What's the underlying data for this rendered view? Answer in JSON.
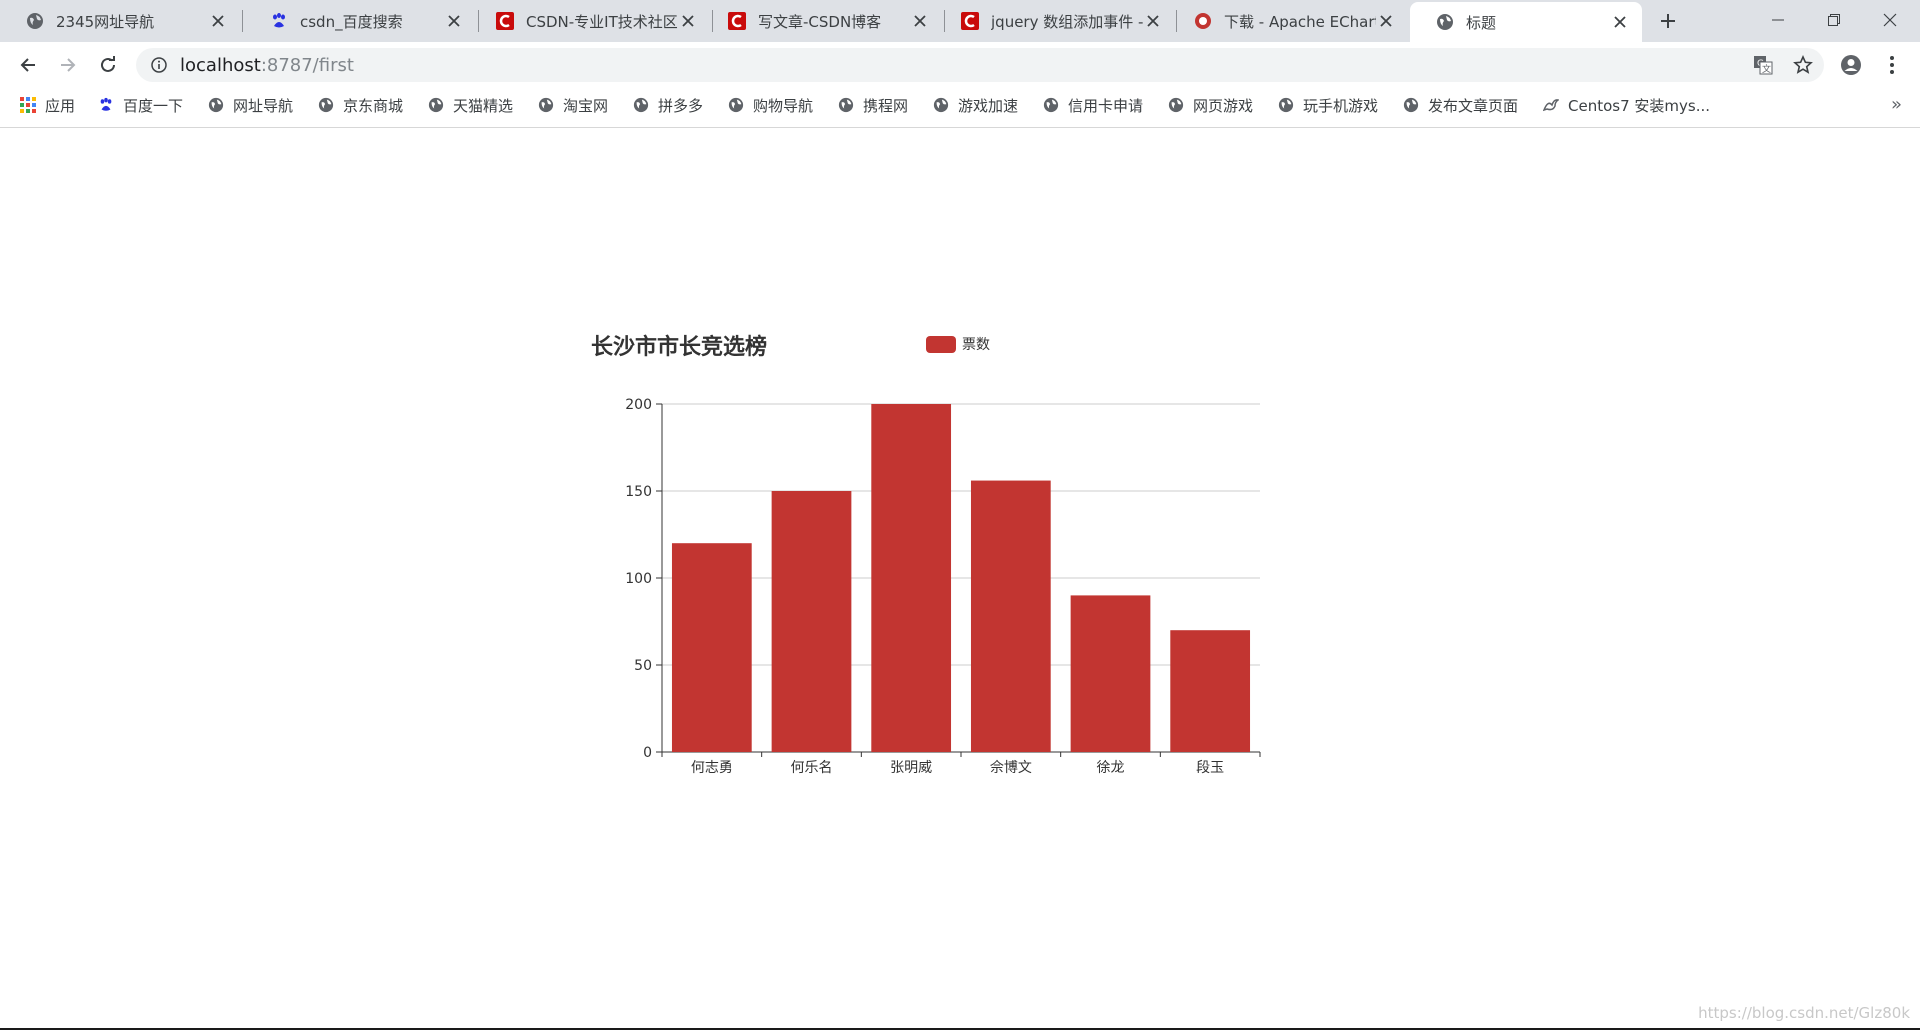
{
  "browser": {
    "tabs": [
      {
        "title": "2345网址导航",
        "favicon": "globe-icon"
      },
      {
        "title": "csdn_百度搜索",
        "favicon": "baidu-paw-icon"
      },
      {
        "title": "CSDN-专业IT技术社区",
        "favicon": "csdn-icon"
      },
      {
        "title": "写文章-CSDN博客",
        "favicon": "csdn-icon"
      },
      {
        "title": "jquery 数组添加事件 -",
        "favicon": "csdn-icon"
      },
      {
        "title": "下载 - Apache EChart",
        "favicon": "echarts-icon"
      },
      {
        "title": "标题",
        "favicon": "globe-icon",
        "active": true
      }
    ],
    "address": {
      "host": "localhost",
      "path": ":8787/first"
    },
    "bookmarks": [
      {
        "label": "应用",
        "icon": "apps-grid-icon"
      },
      {
        "label": "百度一下",
        "icon": "baidu-paw-icon"
      },
      {
        "label": "网址导航",
        "icon": "globe-icon"
      },
      {
        "label": "京东商城",
        "icon": "globe-icon"
      },
      {
        "label": "天猫精选",
        "icon": "globe-icon"
      },
      {
        "label": "淘宝网",
        "icon": "globe-icon"
      },
      {
        "label": "拼多多",
        "icon": "globe-icon"
      },
      {
        "label": "购物导航",
        "icon": "globe-icon"
      },
      {
        "label": "携程网",
        "icon": "globe-icon"
      },
      {
        "label": "游戏加速",
        "icon": "globe-icon"
      },
      {
        "label": "信用卡申请",
        "icon": "globe-icon"
      },
      {
        "label": "网页游戏",
        "icon": "globe-icon"
      },
      {
        "label": "玩手机游戏",
        "icon": "globe-icon"
      },
      {
        "label": "发布文章页面",
        "icon": "globe-icon"
      },
      {
        "label": "Centos7 安装mys...",
        "icon": "bird-icon"
      }
    ],
    "bookmarks_overflow": "»"
  },
  "colors": {
    "bar": "#c23531",
    "axis": "#333333",
    "grid": "#cccccc"
  },
  "chart_data": {
    "type": "bar",
    "title": "长沙市市长竞选榜",
    "categories": [
      "何志勇",
      "何乐名",
      "张明威",
      "佘博文",
      "徐龙",
      "段玉"
    ],
    "series": [
      {
        "name": "票数",
        "values": [
          120,
          150,
          200,
          156,
          90,
          70
        ]
      }
    ],
    "ylim": [
      0,
      200
    ],
    "yticks": [
      0,
      50,
      100,
      150,
      200
    ],
    "grid": true,
    "legend": "top"
  },
  "watermark": "https://blog.csdn.net/Glz80k"
}
